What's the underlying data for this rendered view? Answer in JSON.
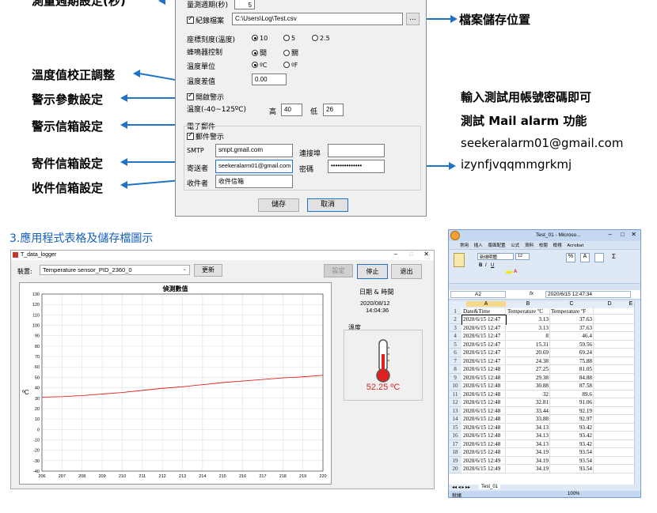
{
  "annotations": {
    "left": [
      {
        "text": "測量週期設定(秒)"
      },
      {
        "text": "溫度值校正調整"
      },
      {
        "text": "警示參數設定"
      },
      {
        "text": "警示信箱設定"
      },
      {
        "text": "寄件信箱設定"
      },
      {
        "text": "收件信箱設定"
      }
    ],
    "file_location": "檔案儲存位置",
    "account_note_1": "輸入測試用帳號密碼即可",
    "account_note_2": "測試 Mail alarm 功能",
    "account_email": "seekeralarm01@gmail.com",
    "account_password": "izynfjvqqmmgrkmj"
  },
  "settings_dialog": {
    "period_label": "量測週期(秒)",
    "period_value": "5",
    "log_file_label": "紀錄檔案",
    "log_file_path": "C:\\Users\\Log\\Test.csv",
    "browse_label": "...",
    "scale_label": "座標刻度(溫度)",
    "scale_options": [
      "10",
      "5",
      "2.5"
    ],
    "buzzer_label": "蜂鳴器控制",
    "buzzer_on": "開",
    "buzzer_off": "關",
    "unit_label": "溫度單位",
    "unit_c": "ºC",
    "unit_f": "ºF",
    "offset_label": "溫度差值",
    "offset_value": "0.00",
    "alarm_enable_label": "開啟警示",
    "alarm_range_label": "溫度(-40~125ºC)",
    "high_label": "高",
    "high_value": "40",
    "low_label": "低",
    "low_value": "26",
    "email_group_label": "電子郵件",
    "mail_alarm_label": "郵件警示",
    "smtp_label": "SMTP",
    "smtp_value": "smpt.gmail.com",
    "port_label": "連接埠",
    "sender_label": "寄送者",
    "sender_value": "seekeralarm01@gmail.com",
    "password_label": "密碼",
    "password_value": "••••••••••••••",
    "receiver_label": "收件者",
    "receiver_value": "收件信箱",
    "save_label": "儲存",
    "cancel_label": "取消"
  },
  "section_title": "3.應用程式表格及儲存檔圖示",
  "logger_window": {
    "title": "T_data_logger",
    "device_label": "裝置:",
    "device_value": "Temperature sensor_PID_2360_0",
    "update_label": "更新",
    "settings_label": "設定",
    "stop_label": "停止",
    "exit_label": "退出",
    "chart_title": "偵測數值",
    "y_unit": "ºC",
    "datetime_label": "日期 & 時間",
    "date": "2020/08/12",
    "time": "14:04:36",
    "temp_label": "溫度",
    "temp_reading": "52.25 ºC",
    "thermometer_icon": "thermometer-icon",
    "accent_red": "#e02020"
  },
  "chart_data": {
    "type": "line",
    "title": "偵測數值",
    "xlabel": "",
    "ylabel": "ºC",
    "x_ticks": [
      206,
      207,
      208,
      209,
      210,
      211,
      212,
      213,
      214,
      215,
      216,
      217,
      218,
      219,
      220
    ],
    "y_ticks": [
      -40,
      -30,
      -20,
      -10,
      0,
      10,
      20,
      30,
      40,
      50,
      60,
      70,
      80,
      90,
      100,
      110,
      120,
      130
    ],
    "xlim": [
      206,
      220
    ],
    "ylim": [
      -40,
      130
    ],
    "grid": true,
    "series": [
      {
        "x": [
          206,
          207,
          208,
          209,
          210,
          211,
          212,
          213,
          214,
          215,
          216,
          217,
          218,
          219,
          220
        ],
        "values": [
          31,
          31.5,
          32.5,
          34,
          35.5,
          37.5,
          39.5,
          41,
          43,
          45,
          46.5,
          48,
          49.5,
          50.5,
          52
        ],
        "color": "#e02020"
      }
    ]
  },
  "excel": {
    "title": "Test_01 - Microso...",
    "ribbon_tabs": [
      "常用",
      "插入",
      "版面配置",
      "公式",
      "資料",
      "校閱",
      "檢視",
      "Acrobat"
    ],
    "font_name": "新細明體",
    "font_size": "12",
    "name_box": "A2",
    "formula": "2020/6/15  12:47:34",
    "columns": [
      "A",
      "B",
      "C",
      "D",
      "E"
    ],
    "headers": [
      "Date&Time",
      "Temperature ºC",
      "Temperature ºF"
    ],
    "rows": [
      [
        "2020/6/15 12:47",
        "3.13",
        "37.63"
      ],
      [
        "2020/6/15 12:47",
        "3.13",
        "37.63"
      ],
      [
        "2020/6/15 12:47",
        "8",
        "46.4"
      ],
      [
        "2020/6/15 12:47",
        "15.31",
        "59.56"
      ],
      [
        "2020/6/15 12:47",
        "20.69",
        "69.24"
      ],
      [
        "2020/6/15 12:47",
        "24.38",
        "75.88"
      ],
      [
        "2020/6/15 12:48",
        "27.25",
        "81.05"
      ],
      [
        "2020/6/15 12:48",
        "29.38",
        "84.88"
      ],
      [
        "2020/6/15 12:48",
        "30.88",
        "87.58"
      ],
      [
        "2020/6/15 12:48",
        "32",
        "89.6"
      ],
      [
        "2020/6/15 12:48",
        "32.81",
        "91.06"
      ],
      [
        "2020/6/15 12:48",
        "33.44",
        "92.19"
      ],
      [
        "2020/6/15 12:48",
        "33.88",
        "92.97"
      ],
      [
        "2020/6/15 12:48",
        "34.13",
        "93.42"
      ],
      [
        "2020/6/15 12:48",
        "34.13",
        "93.42"
      ],
      [
        "2020/6/15 12:48",
        "34.13",
        "93.42"
      ],
      [
        "2020/6/15 12:48",
        "34.19",
        "93.54"
      ],
      [
        "2020/6/15 12:49",
        "34.19",
        "93.54"
      ],
      [
        "2020/6/15 12:49",
        "34.19",
        "93.54"
      ]
    ],
    "sheet_tab": "Test_01",
    "status_ready": "就緒",
    "zoom": "100%"
  }
}
